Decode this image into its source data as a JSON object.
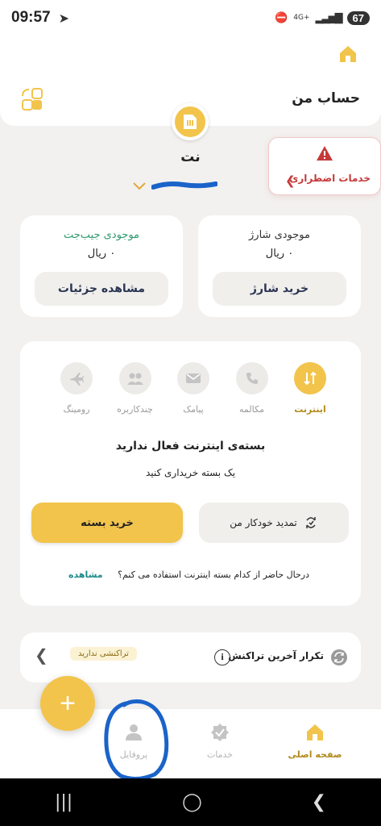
{
  "status_bar": {
    "time": "09:57",
    "network": "4G+",
    "battery": "67"
  },
  "header": {
    "title": "حساب من"
  },
  "sim": {
    "operator_name": "نت"
  },
  "emergency": {
    "label": "خدمات اضطراری"
  },
  "charge_card": {
    "title": "موجودی شارژ",
    "amount": "۰ ریال",
    "button": "خرید شارژ"
  },
  "wallet_card": {
    "title": "موجودی جیب‌جت",
    "amount": "۰ ریال",
    "button": "مشاهده جزئیات"
  },
  "service_tabs": [
    {
      "label": "اینترنت",
      "icon": "internet-icon",
      "active": true
    },
    {
      "label": "مکالمه",
      "icon": "phone-icon",
      "active": false
    },
    {
      "label": "پیامک",
      "icon": "sms-icon",
      "active": false
    },
    {
      "label": "چندکاربره",
      "icon": "multi-user-icon",
      "active": false
    },
    {
      "label": "رومینگ",
      "icon": "airplane-icon",
      "active": false
    }
  ],
  "package": {
    "no_package": "بسته‌ی اینترنت فعال ندارید",
    "buy_hint": "یک بسته خریداری کنید",
    "renew_button": "تمدید خودکار من",
    "buy_button": "خرید بسته",
    "which_question": "درحال حاضر از کدام بسته اینترنت استفاده می کنم؟",
    "which_link": "مشاهده"
  },
  "repeat": {
    "label": "تکرار آخرین تراکنش",
    "badge": "تراکنشی ندارید"
  },
  "bottom_nav": {
    "home": "صفحه اصلی",
    "services": "خدمات",
    "profile": "پروفایل"
  },
  "colors": {
    "accent": "#f2c44c",
    "danger": "#c63a3a",
    "link": "#1f8a8a",
    "annotation": "#1a63c9"
  }
}
